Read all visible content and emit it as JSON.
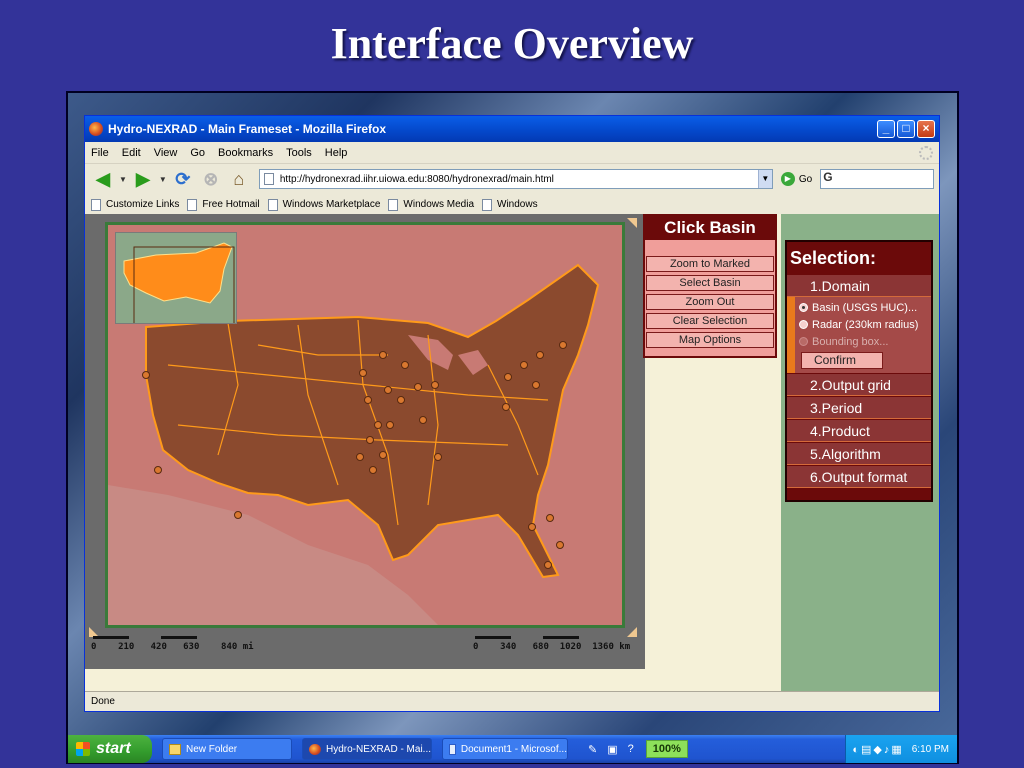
{
  "slide": {
    "title": "Interface Overview"
  },
  "window": {
    "title": "Hydro-NEXRAD - Main Frameset - Mozilla Firefox",
    "minimize": "_",
    "maximize": "□",
    "close": "×"
  },
  "menu": [
    "File",
    "Edit",
    "View",
    "Go",
    "Bookmarks",
    "Tools",
    "Help"
  ],
  "nav": {
    "url": "http://hydronexrad.iihr.uiowa.edu:8080/hydronexrad/main.html",
    "go_label": "Go",
    "search_value": "G"
  },
  "bookmarks": [
    "Customize Links",
    "Free Hotmail",
    "Windows Marketplace",
    "Windows Media",
    "Windows"
  ],
  "map": {
    "scale_left": "0    210   420   630    840 mi",
    "scale_right": "0    340   680  1020  1360 km"
  },
  "basin_panel": {
    "title": "Click Basin",
    "buttons": [
      "Zoom to Marked",
      "Select Basin",
      "Zoom Out",
      "Clear Selection",
      "Map Options"
    ]
  },
  "selection": {
    "title": "Selection:",
    "items": [
      "1.Domain",
      "2.Output grid",
      "3.Period",
      "4.Product",
      "5.Algorithm",
      "6.Output format"
    ],
    "domain_options": [
      "Basin (USGS HUC)...",
      "Radar (230km radius)",
      "Bounding box..."
    ],
    "confirm_label": "Confirm"
  },
  "status": {
    "text": "Done"
  },
  "taskbar": {
    "start_label": "start",
    "tasks": [
      "New Folder",
      "Hydro-NEXRAD - Mai...",
      "Document1 - Microsof..."
    ],
    "zoom": "100%",
    "time": "6:10 PM"
  },
  "colors": {
    "map_land": "#8b4a2e",
    "map_water": "#c87a74",
    "river_lines": "#ff9a1a",
    "panel_header": "#6b0a0a"
  }
}
